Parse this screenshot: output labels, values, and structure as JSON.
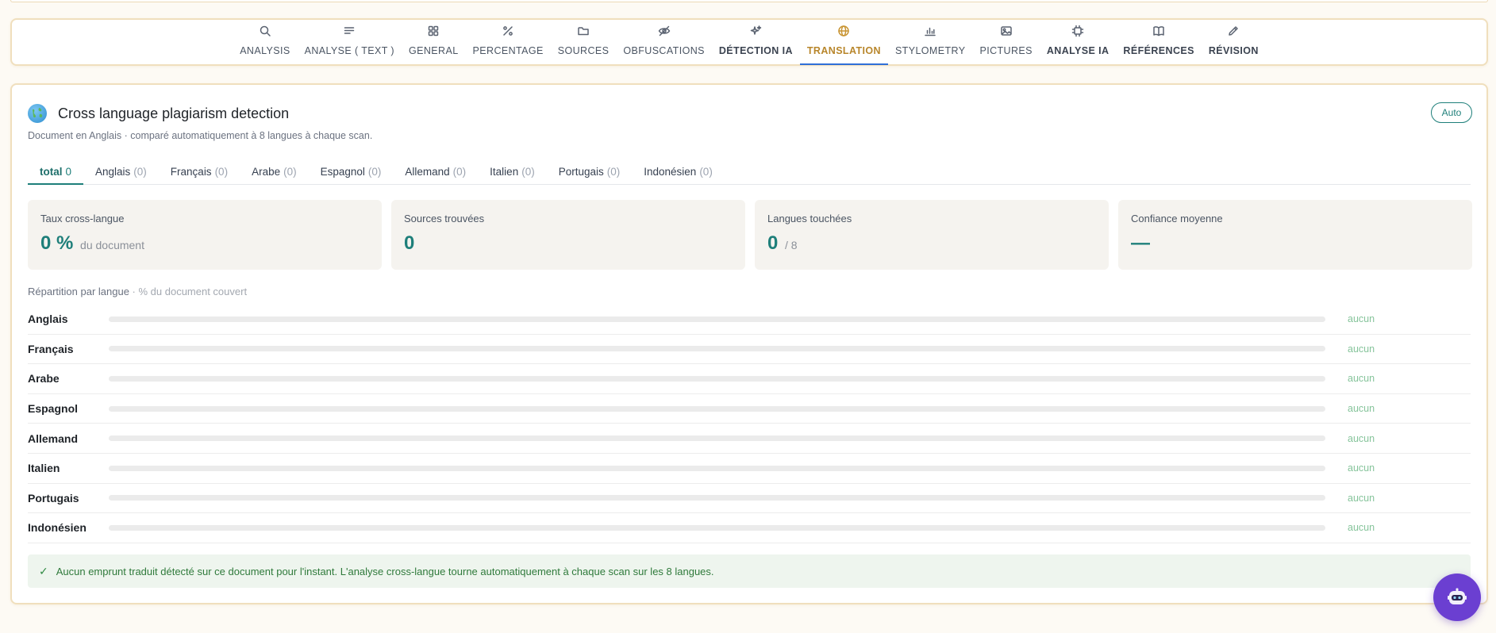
{
  "nav": {
    "items": [
      {
        "label": "ANALYSIS",
        "icon": "search-icon"
      },
      {
        "label": "ANALYSE ( TEXT )",
        "icon": "text-lines-icon"
      },
      {
        "label": "GENERAL",
        "icon": "grid-icon"
      },
      {
        "label": "PERCENTAGE",
        "icon": "percent-icon"
      },
      {
        "label": "SOURCES",
        "icon": "folder-icon"
      },
      {
        "label": "OBFUSCATIONS",
        "icon": "eye-off-icon"
      },
      {
        "label": "DÉTECTION IA",
        "icon": "sparkles-icon"
      },
      {
        "label": "TRANSLATION",
        "icon": "globe-icon",
        "active": true
      },
      {
        "label": "STYLOMETRY",
        "icon": "bar-chart-icon"
      },
      {
        "label": "PICTURES",
        "icon": "image-icon"
      },
      {
        "label": "ANALYSE IA",
        "icon": "chip-icon"
      },
      {
        "label": "RÉFÉRENCES",
        "icon": "book-icon"
      },
      {
        "label": "RÉVISION",
        "icon": "pencil-icon"
      }
    ]
  },
  "panel": {
    "title": "Cross language plagiarism detection",
    "subtitle": "Document en Anglais · comparé automatiquement à 8 langues à chaque scan.",
    "auto_label": "Auto"
  },
  "tabs": [
    {
      "label": "total",
      "count": "0"
    },
    {
      "label": "Anglais",
      "count": "(0)"
    },
    {
      "label": "Français",
      "count": "(0)"
    },
    {
      "label": "Arabe",
      "count": "(0)"
    },
    {
      "label": "Espagnol",
      "count": "(0)"
    },
    {
      "label": "Allemand",
      "count": "(0)"
    },
    {
      "label": "Italien",
      "count": "(0)"
    },
    {
      "label": "Portugais",
      "count": "(0)"
    },
    {
      "label": "Indonésien",
      "count": "(0)"
    }
  ],
  "stats": {
    "rate": {
      "label": "Taux cross-langue",
      "value": "0 %",
      "suffix": "du document"
    },
    "sources": {
      "label": "Sources trouvées",
      "value": "0"
    },
    "languages": {
      "label": "Langues touchées",
      "value": "0",
      "suffix": "/ 8"
    },
    "confidence": {
      "label": "Confiance moyenne",
      "value": "—"
    }
  },
  "distribution": {
    "title": "Répartition par langue",
    "subtitle": "· % du document couvert",
    "rows": [
      {
        "name": "Anglais",
        "status": "aucun",
        "coverage": 0
      },
      {
        "name": "Français",
        "status": "aucun",
        "coverage": 0
      },
      {
        "name": "Arabe",
        "status": "aucun",
        "coverage": 0
      },
      {
        "name": "Espagnol",
        "status": "aucun",
        "coverage": 0
      },
      {
        "name": "Allemand",
        "status": "aucun",
        "coverage": 0
      },
      {
        "name": "Italien",
        "status": "aucun",
        "coverage": 0
      },
      {
        "name": "Portugais",
        "status": "aucun",
        "coverage": 0
      },
      {
        "name": "Indonésien",
        "status": "aucun",
        "coverage": 0
      }
    ]
  },
  "notice": {
    "check": "✓",
    "text": "Aucun emprunt traduit détecté sur ce document pour l'instant. L'analyse cross-langue tourne automatiquement à chaque scan sur les 8 langues."
  },
  "colors": {
    "accent": "#1e7f7a",
    "active_tab": "#b8862b",
    "card_border": "#f0dfbd",
    "assistant": "#6b3fd1"
  },
  "assistant": {
    "icon": "robot-icon"
  }
}
